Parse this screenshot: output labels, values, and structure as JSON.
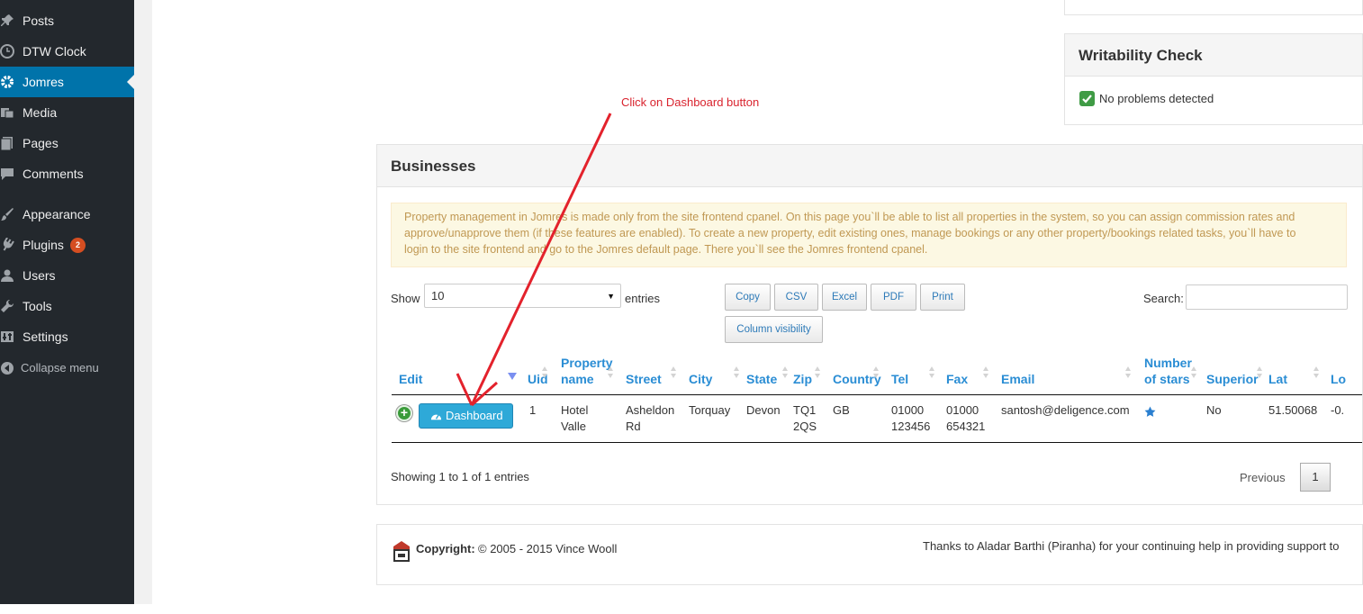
{
  "sidebar": {
    "items": [
      {
        "label": "Posts",
        "icon": "pin-icon"
      },
      {
        "label": "DTW Clock",
        "icon": "clock-icon"
      },
      {
        "label": "Jomres",
        "icon": "gear-icon"
      },
      {
        "label": "Media",
        "icon": "media-icon"
      },
      {
        "label": "Pages",
        "icon": "pages-icon"
      },
      {
        "label": "Comments",
        "icon": "comment-icon"
      },
      {
        "label": "Appearance",
        "icon": "brush-icon"
      },
      {
        "label": "Plugins",
        "icon": "plug-icon",
        "badge": "2"
      },
      {
        "label": "Users",
        "icon": "user-icon"
      },
      {
        "label": "Tools",
        "icon": "wrench-icon"
      },
      {
        "label": "Settings",
        "icon": "settings-icon"
      },
      {
        "label": "Collapse menu",
        "icon": "collapse-icon"
      }
    ]
  },
  "writability": {
    "title": "Writability Check",
    "status": "No problems detected"
  },
  "annotation": "Click on Dashboard button",
  "businesses": {
    "title": "Businesses",
    "notice_lines": [
      "Property management in Jomres is made only from the site frontend cpanel. On this page you`ll be able to list all properties in the system, so you can assign commission rates and",
      "approve/unapprove them (if these features are enabled). To create a new property, edit existing ones, manage bookings or any other property/bookings related tasks, you`ll have to",
      "login to the site frontend and go to the Jomres default page. There you`ll see the Jomres frontend cpanel."
    ],
    "show_label": "Show",
    "entries_value": "10",
    "entries_label": "entries",
    "buttons": [
      "Copy",
      "CSV",
      "Excel",
      "PDF",
      "Print"
    ],
    "column_visibility": "Column visibility",
    "search_label": "Search:",
    "columns": [
      "Edit",
      "Uid",
      "Property name",
      "Street",
      "City",
      "State",
      "Zip",
      "Country",
      "Tel",
      "Fax",
      "Email",
      "Number of stars",
      "Superior",
      "Lat",
      "Lo"
    ],
    "row": {
      "dashboard_label": "Dashboard",
      "uid": "1",
      "property_name": "Hotel Valle",
      "street": "Asheldon Rd",
      "city": "Torquay",
      "state": "Devon",
      "zip": "TQ1 2QS",
      "country": "GB",
      "tel": "01000 123456",
      "fax": "01000 654321",
      "email": "santosh@deligence.com",
      "stars": 1,
      "superior": "No",
      "lat": "51.50068",
      "lon": "-0."
    },
    "info": "Showing 1 to 1 of 1 entries",
    "previous": "Previous",
    "page": "1"
  },
  "footer": {
    "copyright_label": "Copyright:",
    "copyright_text": "© 2005 - 2015 Vince Wooll",
    "thanks": "Thanks to Aladar Barthi (Piranha) for your continuing help in providing support to"
  },
  "colors": {
    "sidebar_bg": "#23282d",
    "active": "#0073aa",
    "link": "#2a8dd4",
    "button": "#2ea9d8",
    "annotation": "#d9232e"
  }
}
